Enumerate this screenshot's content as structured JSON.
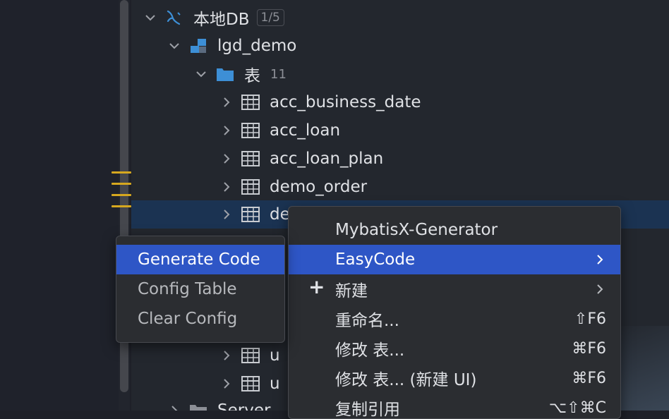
{
  "tree": {
    "db": {
      "label": "本地DB",
      "badge": "1/5"
    },
    "schema": {
      "label": "lgd_demo"
    },
    "tables_folder": {
      "label": "表",
      "count": "11"
    },
    "tables": [
      "acc_business_date",
      "acc_loan",
      "acc_loan_plan",
      "demo_order",
      "de"
    ],
    "partial_rows": [
      "u",
      "u"
    ],
    "bottom_row": "Server"
  },
  "context_menu": {
    "items": [
      {
        "label": "MybatisX-Generator"
      },
      {
        "label": "EasyCode",
        "submenu": true
      },
      {
        "label": "新建",
        "submenu": true,
        "icon": "plus-icon"
      },
      {
        "label": "重命名...",
        "shortcut": "⇧F6"
      },
      {
        "label": "修改 表...",
        "shortcut": "⌘F6"
      },
      {
        "label": "修改 表... (新建 UI)",
        "shortcut": "⌘F6"
      },
      {
        "label": "复制引用",
        "shortcut": "⌥⇧⌘C"
      }
    ]
  },
  "submenu": {
    "items": [
      {
        "label": "Generate Code"
      },
      {
        "label": "Config Table"
      },
      {
        "label": "Clear Config"
      }
    ]
  },
  "colors": {
    "highlight": "#2e56c6",
    "selection": "#1b3352",
    "folder": "#3d8fd6",
    "gutter": "#d6a81f"
  }
}
